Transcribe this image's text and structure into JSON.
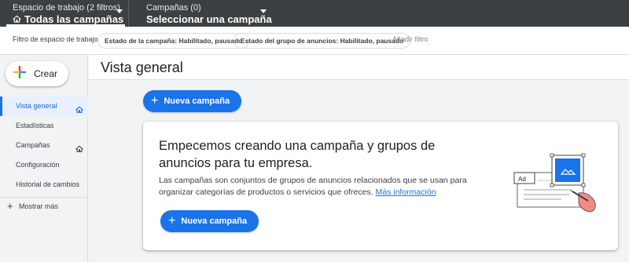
{
  "topbar": {
    "workspace_sub": "Espacio de trabajo (2 filtros)",
    "workspace_main": "Todas las campañas",
    "campaign_sub": "Campañas (0)",
    "campaign_main": "Seleccionar una campaña"
  },
  "filters": {
    "label": "Filtro de espacio de trabajo",
    "chips": [
      "Estado de la campaña: Habilitado, pausado",
      "Estado del grupo de anuncios: Habilitado, pausado"
    ],
    "add": "Añadir filtro"
  },
  "sidebar": {
    "create_label": "Crear",
    "items": [
      {
        "label": "Vista general",
        "icon": "home-icon"
      },
      {
        "label": "Estadísticas"
      },
      {
        "label": "Campañas",
        "icon": "home-icon"
      },
      {
        "label": "Configuración"
      },
      {
        "label": "Historial de cambios"
      }
    ],
    "more_label": "Mostrar más"
  },
  "main": {
    "title": "Vista general",
    "new_campaign_label": "Nueva campaña",
    "card": {
      "title": "Empecemos creando una campaña y grupos de anuncios para tu empresa.",
      "body": "Las campañas son conjuntos de grupos de anuncios relacionados que se usan para organizar categorías de productos o servicios que ofreces.",
      "link": "Más información",
      "button_label": "Nueva campaña",
      "illustration_text": "Ad"
    }
  },
  "colors": {
    "topbar": "#3c4043",
    "accent": "#1a73e8",
    "active_bg": "#e8f0fe"
  }
}
